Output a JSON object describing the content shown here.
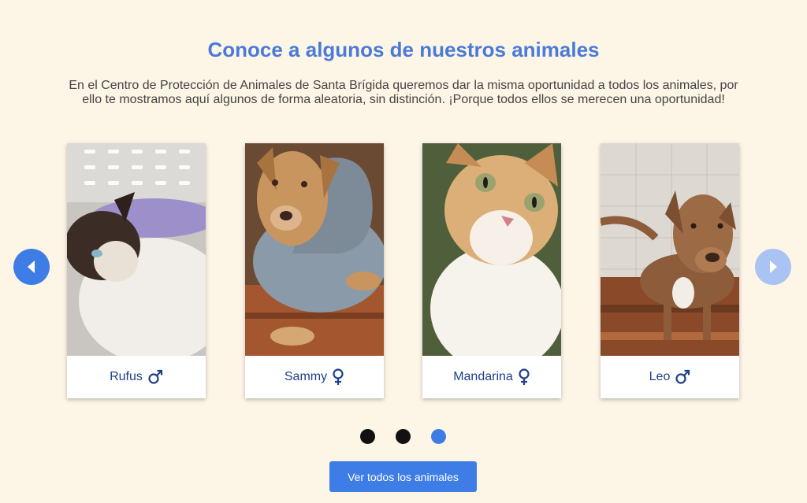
{
  "section": {
    "title": "Conoce a algunos de nuestros animales",
    "intro": "En el Centro de Protección de Animales de Santa Brígida queremos dar la misma oportunidad a todos los animales, por ello te mostramos aquí algunos de forma aleatoria, sin distinción. ¡Porque todos ellos se merecen una oportunidad!"
  },
  "carousel": {
    "prev_icon": "chevron-left-icon",
    "next_icon": "chevron-right-icon",
    "cards": [
      {
        "name": "Rufus",
        "sex": "male",
        "sex_icon": "male-icon",
        "photo": "cat-photo"
      },
      {
        "name": "Sammy",
        "sex": "female",
        "sex_icon": "female-icon",
        "photo": "dog-photo"
      },
      {
        "name": "Mandarina",
        "sex": "female",
        "sex_icon": "female-icon",
        "photo": "cat-photo"
      },
      {
        "name": "Leo",
        "sex": "male",
        "sex_icon": "male-icon",
        "photo": "dog-photo"
      }
    ],
    "pages": 3,
    "active_page": 3
  },
  "cta": {
    "label": "Ver todos los animales"
  },
  "colors": {
    "accent": "#3f7de6",
    "title": "#4a7bd8",
    "background": "#fdf5e6",
    "name_text": "#1e3f8a",
    "dot_inactive": "#111111"
  }
}
